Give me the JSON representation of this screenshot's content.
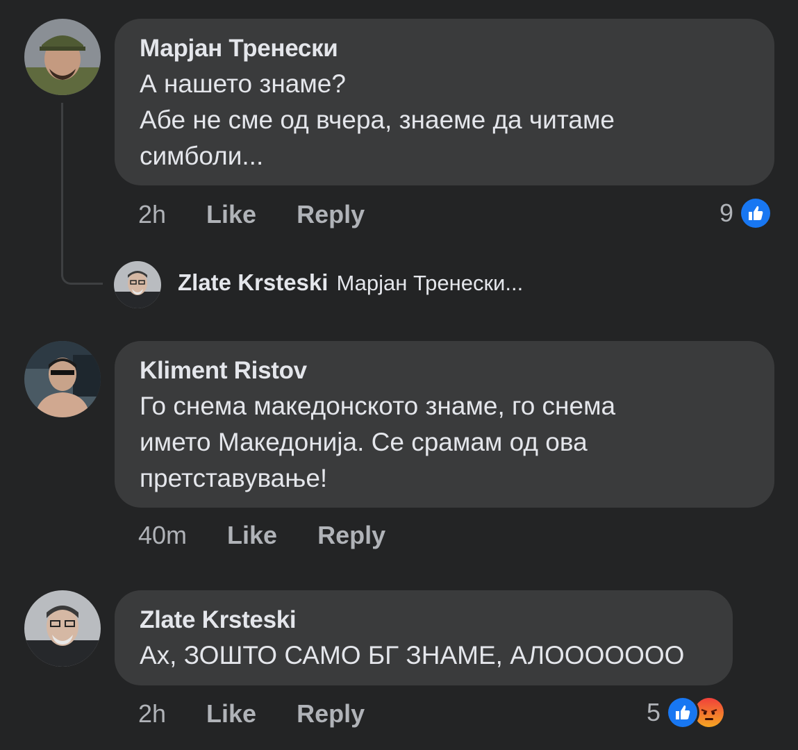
{
  "comments": [
    {
      "author": "Марјан Тренески",
      "text_lines": [
        "А нашето знаме?",
        "Абе не сме од вчера, знаеме да читаме",
        "симболи..."
      ],
      "time": "2h",
      "like": "Like",
      "reply": "Reply",
      "reaction_count": "9"
    },
    {
      "author": "Kliment Ristov",
      "text_lines": [
        "Го снема македонското знаме, го снема",
        "името Македонија. Се срамам од ова",
        "претставување!"
      ],
      "time": "40m",
      "like": "Like",
      "reply": "Reply"
    },
    {
      "author": "Zlate Krsteski",
      "text_lines": [
        "Ах, ЗОШТО САМО БГ ЗНАМЕ, АЛООООООО"
      ],
      "time": "2h",
      "like": "Like",
      "reply": "Reply",
      "reaction_count": "5"
    }
  ],
  "reply_preview": {
    "author": "Zlate Krsteski",
    "snippet": "Марјан Тренески..."
  },
  "colors": {
    "background": "#232425",
    "bubble": "#3a3b3c",
    "like_blue": "#1877f2",
    "angry_red": "#f0413b"
  },
  "icons": [
    "like-reaction-icon",
    "angry-reaction-icon"
  ]
}
